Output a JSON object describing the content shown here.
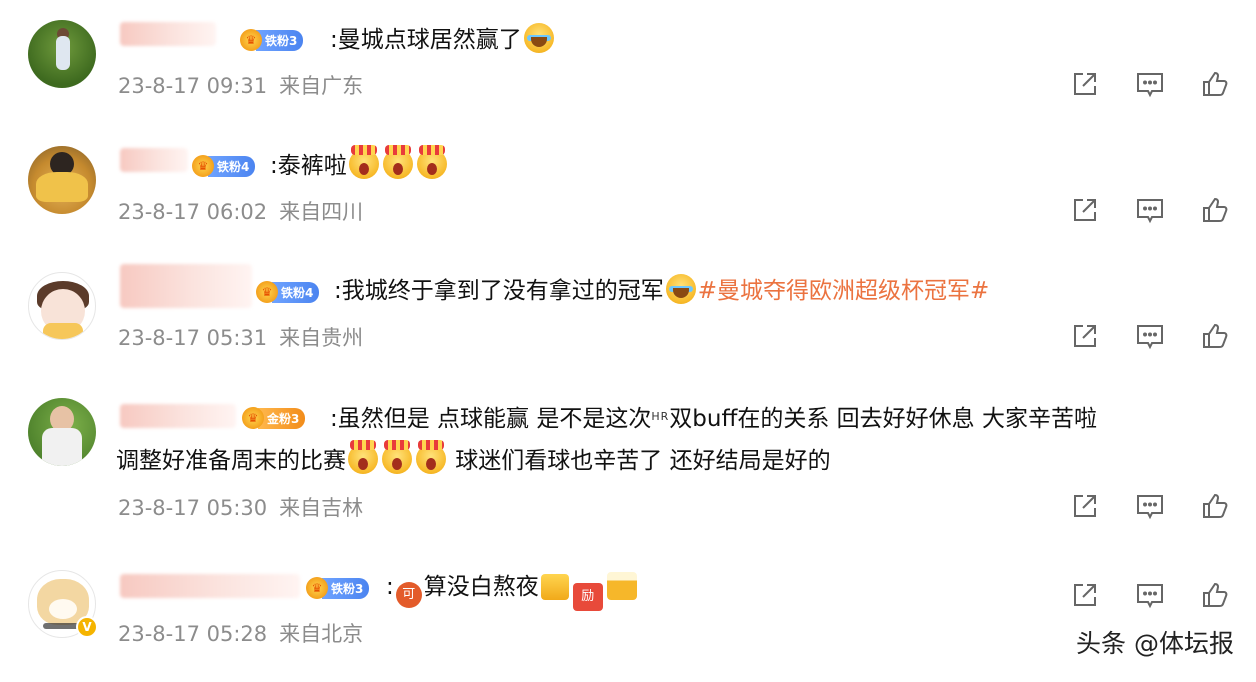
{
  "comments": [
    {
      "fan_badge": "铁粉3",
      "text": ":曼城点球居然赢了",
      "emojis": [
        "cry"
      ],
      "hashtag": "",
      "time": "23-8-17 09:31",
      "location": "来自广东"
    },
    {
      "fan_badge": "铁粉4",
      "text": ":泰裤啦",
      "emojis": [
        "wow",
        "wow",
        "wow"
      ],
      "hashtag": "",
      "time": "23-8-17 06:02",
      "location": "来自四川"
    },
    {
      "fan_badge": "铁粉4",
      "text": ":我城终于拿到了没有拿过的冠军",
      "emojis": [
        "cry"
      ],
      "hashtag": "#曼城夺得欧洲超级杯冠军#",
      "time": "23-8-17 05:31",
      "location": "来自贵州"
    },
    {
      "fan_badge": "金粉3",
      "text_line1_a": ":虽然但是 点球能赢 是不是这次",
      "text_line1_hr": "HR",
      "text_line1_b": "双buff在的关系 回去好好休息 大家辛苦啦",
      "text_line2_a": "调整好准备周末的比赛",
      "text_line2_b": " 球迷们看球也辛苦了 还好结局是好的",
      "emojis": [
        "wow",
        "wow",
        "wow"
      ],
      "time": "23-8-17 05:30",
      "location": "来自吉林"
    },
    {
      "fan_badge": "铁粉3",
      "prefix_tag": "可",
      "text": "算没白熬夜",
      "emojis": [
        "thumb",
        "red",
        "beer"
      ],
      "red_tag": "励",
      "time": "23-8-17 05:28",
      "location": "来自北京",
      "verified_badge": "V"
    }
  ],
  "icons": {
    "share": "share-icon",
    "comment": "comment-icon",
    "like": "like-icon"
  },
  "watermark": "头条 @体坛报"
}
